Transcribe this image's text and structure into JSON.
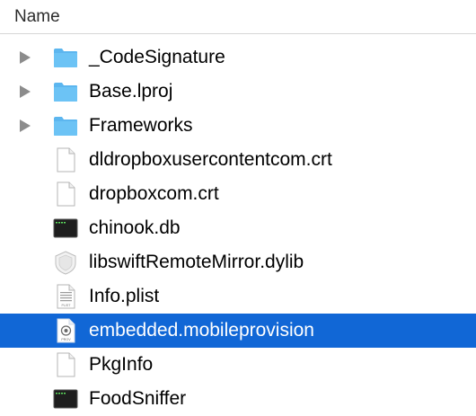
{
  "column_header": {
    "name_label": "Name"
  },
  "colors": {
    "selection": "#1167d6",
    "folder": "#5cb6ef",
    "disclosure": "#8c8c8c"
  },
  "items": [
    {
      "label": "_CodeSignature",
      "icon": "folder-icon",
      "expandable": true
    },
    {
      "label": "Base.lproj",
      "icon": "folder-icon",
      "expandable": true
    },
    {
      "label": "Frameworks",
      "icon": "folder-icon",
      "expandable": true
    },
    {
      "label": "dldropboxusercontentcom.crt",
      "icon": "blank-document-icon"
    },
    {
      "label": "dropboxcom.crt",
      "icon": "blank-document-icon"
    },
    {
      "label": "chinook.db",
      "icon": "executable-icon"
    },
    {
      "label": "libswiftRemoteMirror.dylib",
      "icon": "dylib-shield-icon"
    },
    {
      "label": "Info.plist",
      "icon": "plist-document-icon",
      "icon_text": "PLIST"
    },
    {
      "label": "embedded.mobileprovision",
      "icon": "mobileprovision-icon",
      "icon_text": "PROV",
      "selected": true
    },
    {
      "label": "PkgInfo",
      "icon": "blank-document-icon"
    },
    {
      "label": "FoodSniffer",
      "icon": "executable-icon"
    }
  ]
}
